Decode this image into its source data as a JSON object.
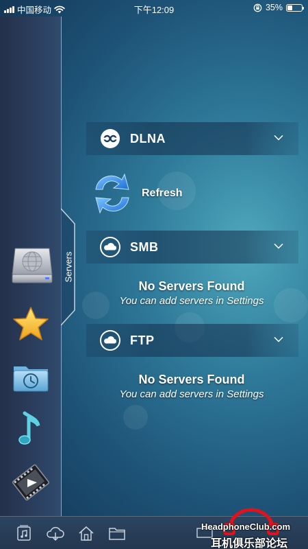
{
  "status_bar": {
    "carrier": "中国移动",
    "time": "下午12:09",
    "battery_percent": "35%",
    "battery_level": 0.35,
    "icons": [
      "signal-icon",
      "wifi-icon",
      "orientation-lock-icon",
      "battery-icon"
    ]
  },
  "sidebar": {
    "active_tab_label": "Servers",
    "items": [
      {
        "name": "servers",
        "icon": "hard-drive-icon"
      },
      {
        "name": "favorites",
        "icon": "star-icon"
      },
      {
        "name": "recent",
        "icon": "clock-folder-icon"
      },
      {
        "name": "music",
        "icon": "music-note-icon"
      },
      {
        "name": "video",
        "icon": "film-icon"
      }
    ]
  },
  "sections": {
    "dlna": {
      "title": "DLNA",
      "icon": "dlna-icon"
    },
    "refresh": {
      "label": "Refresh",
      "icon": "refresh-icon"
    },
    "smb": {
      "title": "SMB",
      "icon": "cloud-icon",
      "empty_title": "No Servers Found",
      "empty_subtitle": "You can add servers in Settings"
    },
    "ftp": {
      "title": "FTP",
      "icon": "cloud-icon",
      "empty_title": "No Servers Found",
      "empty_subtitle": "You can add servers in Settings"
    }
  },
  "bottom_bar": {
    "icons": [
      "music-library-icon",
      "cloud-download-icon",
      "home-icon",
      "folder-icon"
    ]
  },
  "watermark": {
    "line1": "HeadphoneClub.com",
    "line2": "耳机俱乐部论坛"
  },
  "colors": {
    "accent_blue": "#2f8fe0",
    "background": "#2f7a9a",
    "watermark_red": "#e1121b"
  }
}
